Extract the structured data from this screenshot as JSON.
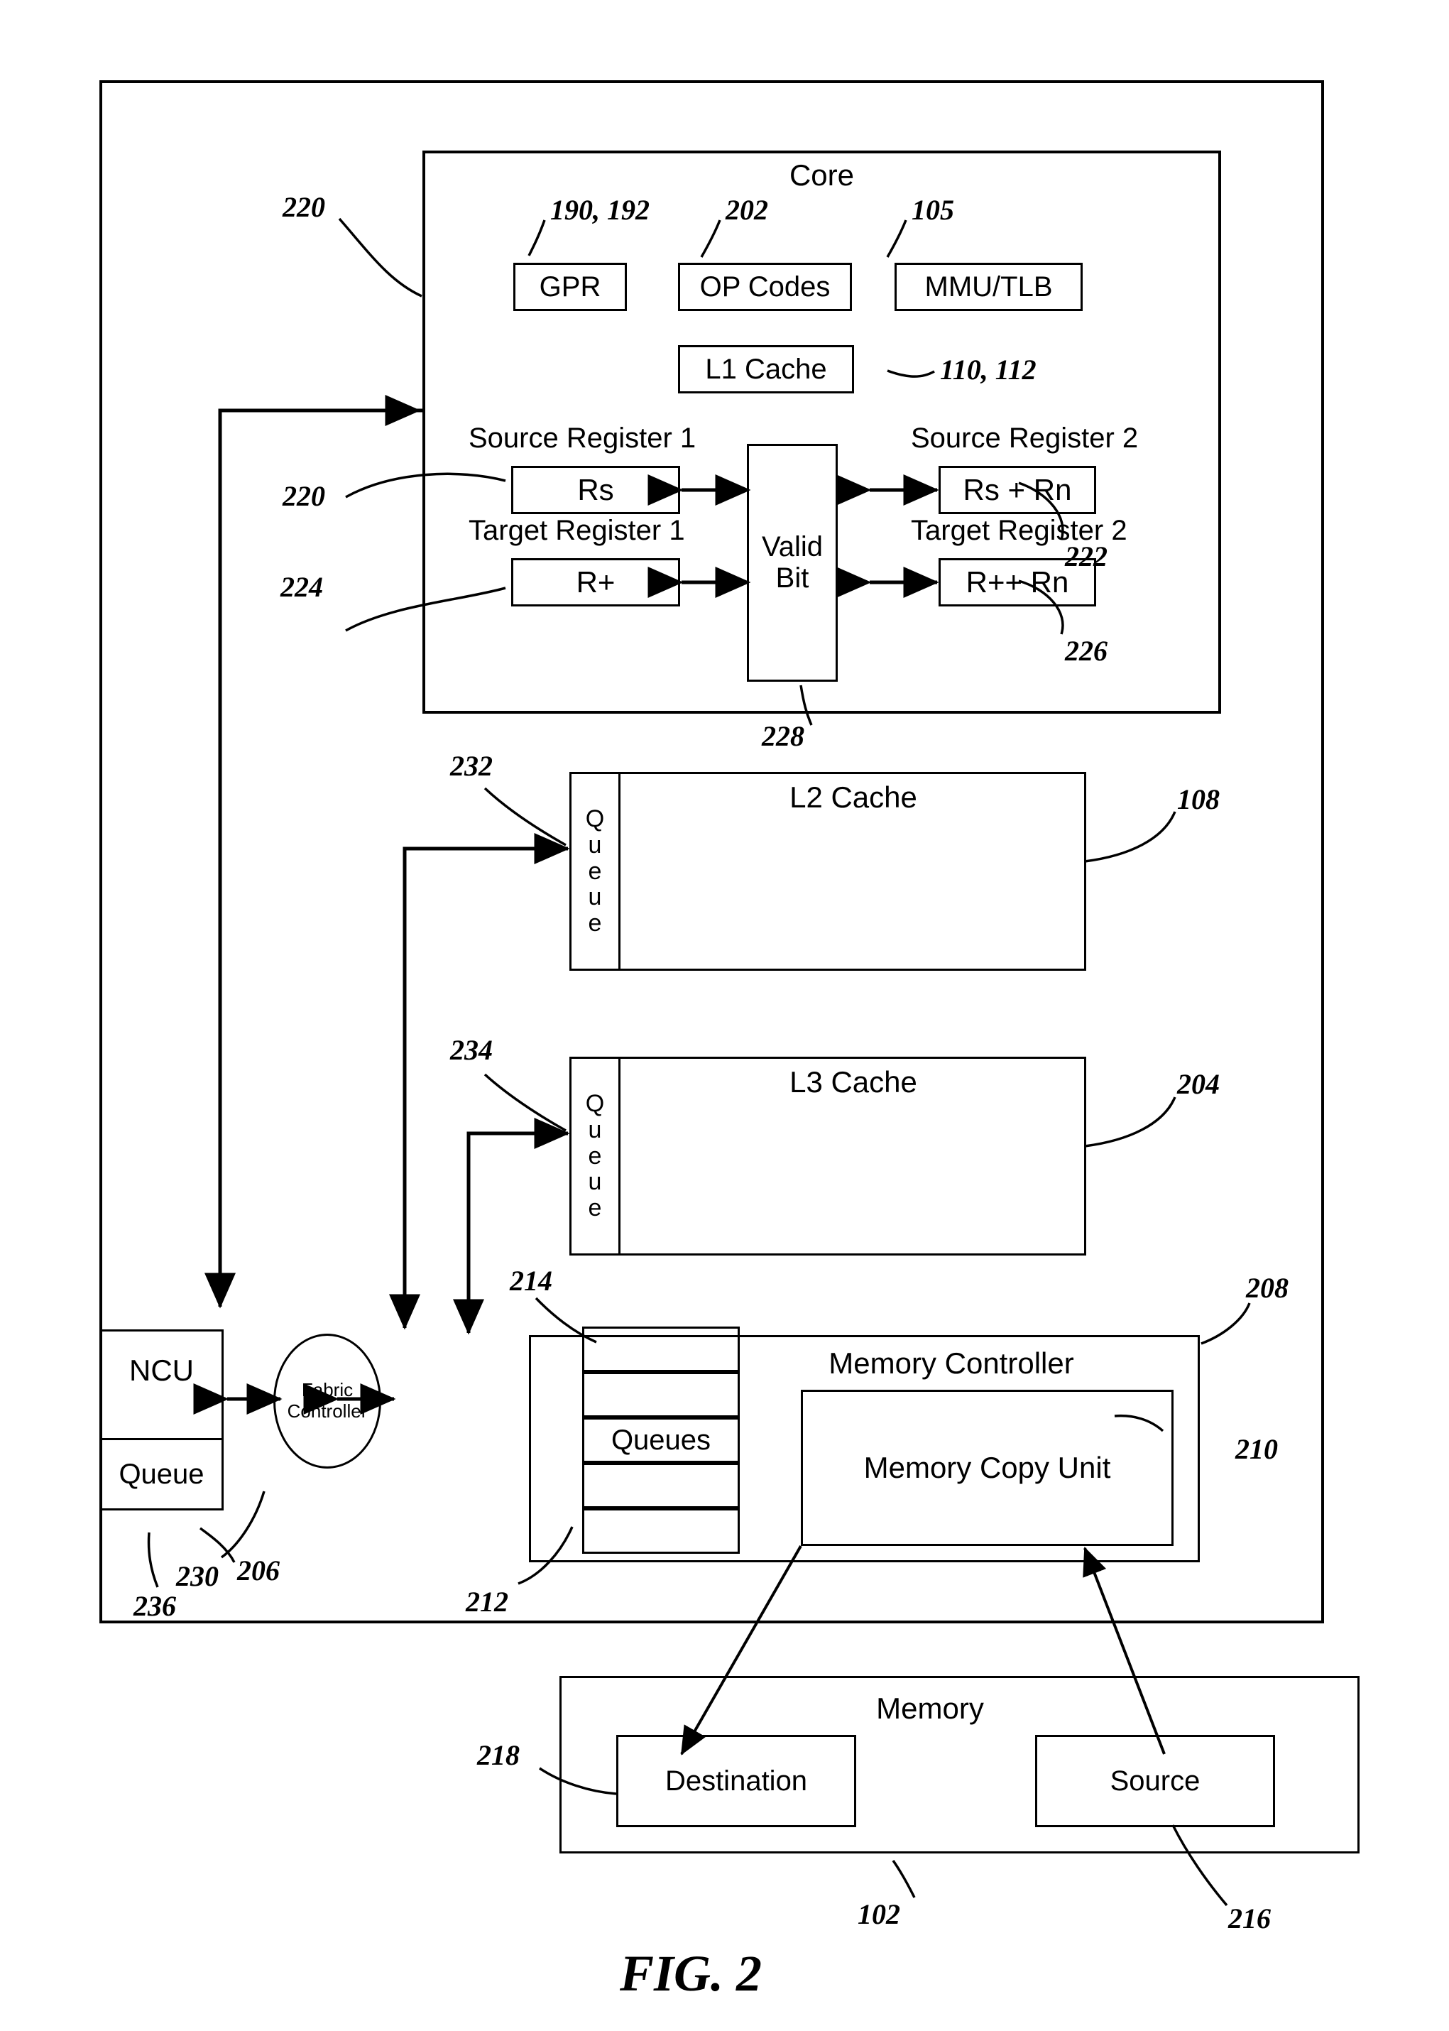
{
  "figure": {
    "title": "FIG. 2",
    "processor_block_ref": "220"
  },
  "core": {
    "title": "Core",
    "units": [
      {
        "label": "GPR",
        "ref": "190, 192"
      },
      {
        "label": "OP Codes",
        "ref": "202"
      },
      {
        "label": "MMU/TLB",
        "ref": "105"
      }
    ],
    "l1_cache": {
      "label": "L1 Cache",
      "ref": "110, 112"
    },
    "valid_bit": {
      "label_line1": "Valid",
      "label_line2": "Bit",
      "ref": "228"
    },
    "registers": [
      {
        "title": "Source Register 1",
        "value": "Rs",
        "ref": "220"
      },
      {
        "title": "Source Register 2",
        "value": "Rs + Rn",
        "ref": "222"
      },
      {
        "title": "Target Register 1",
        "value": "R+",
        "ref": "224"
      },
      {
        "title": "Target Register 2",
        "value": "R++ Rn",
        "ref": "226"
      }
    ]
  },
  "caches": [
    {
      "queue_label": "Queue",
      "name": "L2 Cache",
      "queue_ref": "232",
      "cache_ref": "108"
    },
    {
      "queue_label": "Queue",
      "name": "L3 Cache",
      "queue_ref": "234",
      "cache_ref": "204"
    }
  ],
  "ncu": {
    "label": "NCU",
    "queue_label": "Queue",
    "ref": "206",
    "queue_ref": "236"
  },
  "fabric_controller": {
    "line1": "Fabric",
    "line2": "Controller",
    "ref": "230"
  },
  "memory_controller": {
    "title": "Memory Controller",
    "ref": "208",
    "queues_label": "Queues",
    "queues_ref": "214",
    "queues_outer_ref": "212",
    "copy_unit": {
      "label": "Memory Copy Unit",
      "ref": "210"
    }
  },
  "memory": {
    "title": "Memory",
    "ref": "102",
    "destination": {
      "label": "Destination",
      "ref": "218"
    },
    "source": {
      "label": "Source",
      "ref": "216"
    }
  },
  "colors": {
    "ink": "#000000",
    "paper": "#ffffff"
  }
}
